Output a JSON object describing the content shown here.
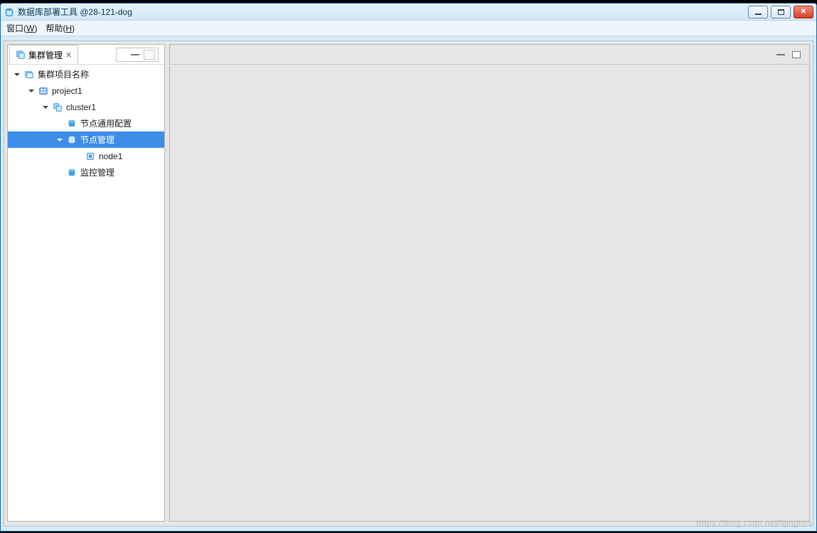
{
  "window": {
    "title": "数据库部署工具 @28-121-dog"
  },
  "menubar": {
    "window_label": "窗口",
    "window_mn": "W",
    "help_label": "帮助",
    "help_mn": "H"
  },
  "left_pane": {
    "tab_label": "集群管理",
    "tree": {
      "root_label": "集群项目名称",
      "project_label": "project1",
      "cluster_label": "cluster1",
      "node_common_cfg_label": "节点通用配置",
      "node_mgmt_label": "节点管理",
      "node1_label": "node1",
      "monitor_mgmt_label": "监控管理"
    }
  },
  "icons": {
    "app": "database-icon",
    "tab": "cluster-stack-icon",
    "root": "folder-stack-icon",
    "project": "project-icon",
    "cluster": "cluster-icon",
    "db": "database-icon",
    "node": "node-chip-icon"
  },
  "colors": {
    "selection": "#3d8ee8",
    "db_icon": "#2f88d6",
    "project_icon": "#3a7bd5",
    "titlebar_text": "#0a3a5a"
  },
  "watermark": "https://blog.csdn.net/lijinglisa"
}
